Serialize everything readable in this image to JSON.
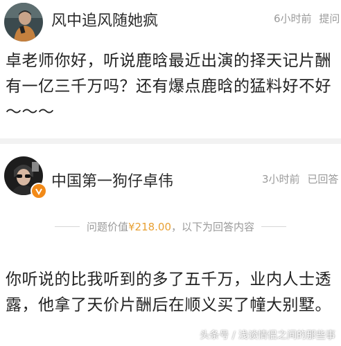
{
  "question": {
    "user_name": "风中追风随她疯",
    "time": "6小时前",
    "action": "提问",
    "text": "卓老师你好，听说鹿晗最近出演的择天记片酬有一亿三千万吗？还有爆点鹿晗的猛料好不好～～～"
  },
  "answer": {
    "user_name": "中国第一狗仔卓伟",
    "time": "3小时前",
    "action": "已回答",
    "price_label": "问题价值",
    "price_amount": "¥218.00",
    "price_suffix": "，以下为回答内容",
    "text": "你听说的比我听到的多了五千万，业内人士透露，他拿了天价片酬后在顺义买了幢大别墅。"
  },
  "watermark": "头条号 / 浅谈情侣之间的那些事",
  "colors": {
    "accent_price": "#e8a033",
    "verified_badge": "#f28a18",
    "meta_text": "#9a9a9a"
  }
}
